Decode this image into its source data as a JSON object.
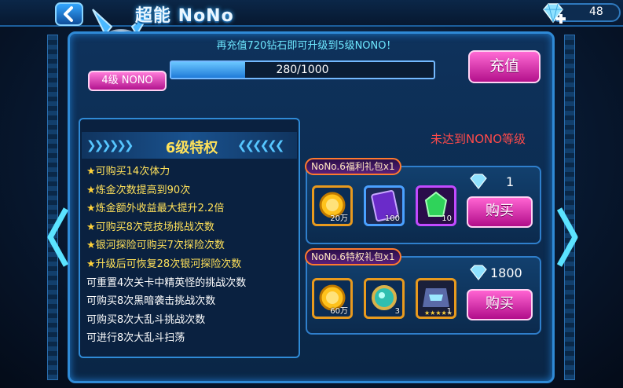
{
  "header": {
    "title": "超能 NoNo",
    "gem_balance": "48"
  },
  "vip": {
    "banner": "再充值720钻石即可升级到5级NONO！",
    "level_label": "4级 NONO",
    "progress_text": "280/1000",
    "progress_value": 0.28,
    "charge_label": "充值"
  },
  "privileges": {
    "title": "6级特权",
    "items": [
      {
        "text": "可购买14次体力",
        "highlight": true
      },
      {
        "text": "炼金次数提高到90次",
        "highlight": true
      },
      {
        "text": "炼金额外收益最大提升2.2倍",
        "highlight": true
      },
      {
        "text": "可购买8次竞技场挑战次数",
        "highlight": true
      },
      {
        "text": "银河探险可购买7次探险次数",
        "highlight": true
      },
      {
        "text": "升级后可恢复28次银河探险次数",
        "highlight": true
      },
      {
        "text": "可重置4次关卡中精英怪的挑战次数",
        "highlight": false
      },
      {
        "text": "可购买8次黑暗袭击挑战次数",
        "highlight": false
      },
      {
        "text": "可购买8次大乱斗挑战次数",
        "highlight": false
      },
      {
        "text": "可进行8次大乱斗扫荡",
        "highlight": false
      }
    ]
  },
  "status": {
    "unmet_text": "未达到NONO等级"
  },
  "packs": [
    {
      "label": "NoNo.6福利礼包x1",
      "price": "1",
      "buy_label": "购买",
      "items": [
        {
          "icon": "gold-coin-icon",
          "qty": "20万"
        },
        {
          "icon": "purple-card-icon",
          "qty": "100"
        },
        {
          "icon": "green-gem-icon",
          "qty": "10"
        }
      ]
    },
    {
      "label": "NoNo.6特权礼包x1",
      "price": "1800",
      "buy_label": "购买",
      "items": [
        {
          "icon": "gold-coin-icon",
          "qty": "60万"
        },
        {
          "icon": "cyan-orb-icon",
          "qty": "3"
        },
        {
          "icon": "robot-portrait-icon",
          "qty": "1"
        }
      ]
    }
  ],
  "colors": {
    "accent_pink": "#e02bb0",
    "frame_blue": "#2f8ad6",
    "warn_red": "#ff4a4a",
    "highlight_yellow": "#ffe15a"
  }
}
